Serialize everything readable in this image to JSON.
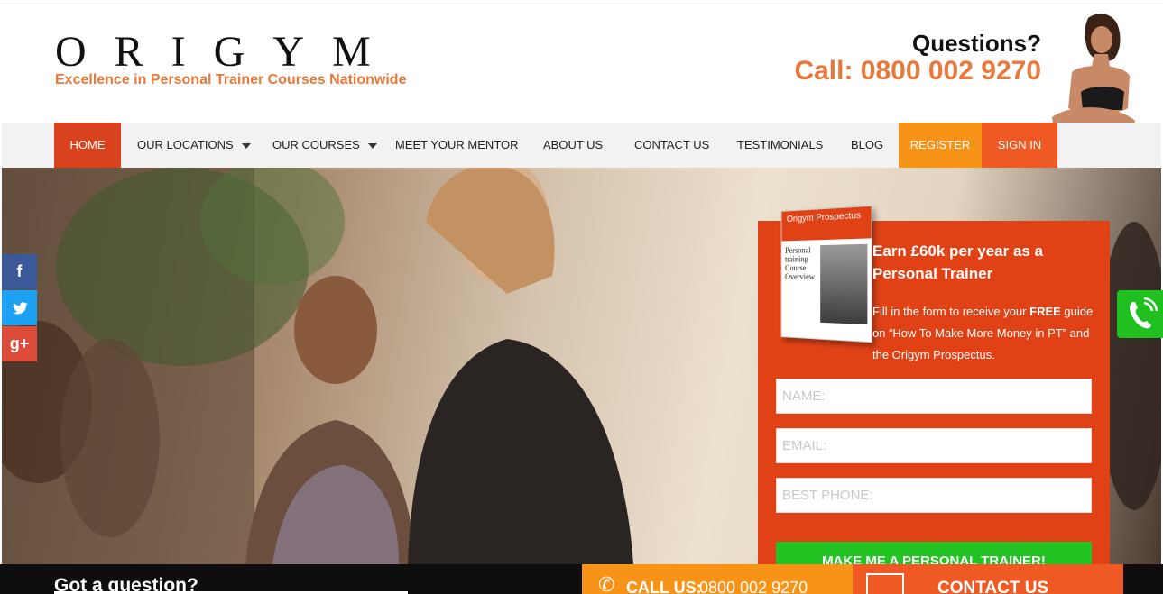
{
  "header": {
    "logo": "ORIGYM",
    "tagline": "Excellence in Personal Trainer Courses Nationwide",
    "questions": "Questions?",
    "call_prefix": "Call: ",
    "call_number": "0800 002 9270"
  },
  "nav": {
    "items": [
      {
        "label": "HOME",
        "active": true
      },
      {
        "label": "OUR LOCATIONS",
        "dropdown": true
      },
      {
        "label": "OUR COURSES",
        "dropdown": true
      },
      {
        "label": "MEET YOUR MENTOR"
      },
      {
        "label": "ABOUT US"
      },
      {
        "label": "CONTACT US"
      },
      {
        "label": "TESTIMONIALS"
      },
      {
        "label": "BLOG"
      },
      {
        "label": "REGISTER"
      },
      {
        "label": "SIGN IN"
      }
    ]
  },
  "social": {
    "facebook": "f",
    "twitter": "twitter-icon",
    "googleplus": "g+"
  },
  "promo": {
    "book_title": "Origym Prospectus",
    "book_text": "Personal training Course Overview",
    "title": "Earn £60k per year as a Personal Trainer",
    "text_before": "Fill in the form to receive your ",
    "text_bold": "FREE",
    "text_after": " guide on “How To Make More Money in PT” and the Origym Prospectus.",
    "name_placeholder": "NAME:",
    "email_placeholder": "EMAIL:",
    "phone_placeholder": "BEST PHONE:",
    "submit_label": "MAKE ME A PERSONAL TRAINER!"
  },
  "bottom": {
    "question": "Got a question?",
    "call_label": "CALL US:",
    "call_number": "0800 002 9270",
    "contact_label": "CONTACT US"
  },
  "colors": {
    "accent_orange": "#e8793a",
    "nav_active": "#d9421f",
    "register": "#f79418",
    "signin": "#ef5a24",
    "submit_green": "#22c322"
  }
}
